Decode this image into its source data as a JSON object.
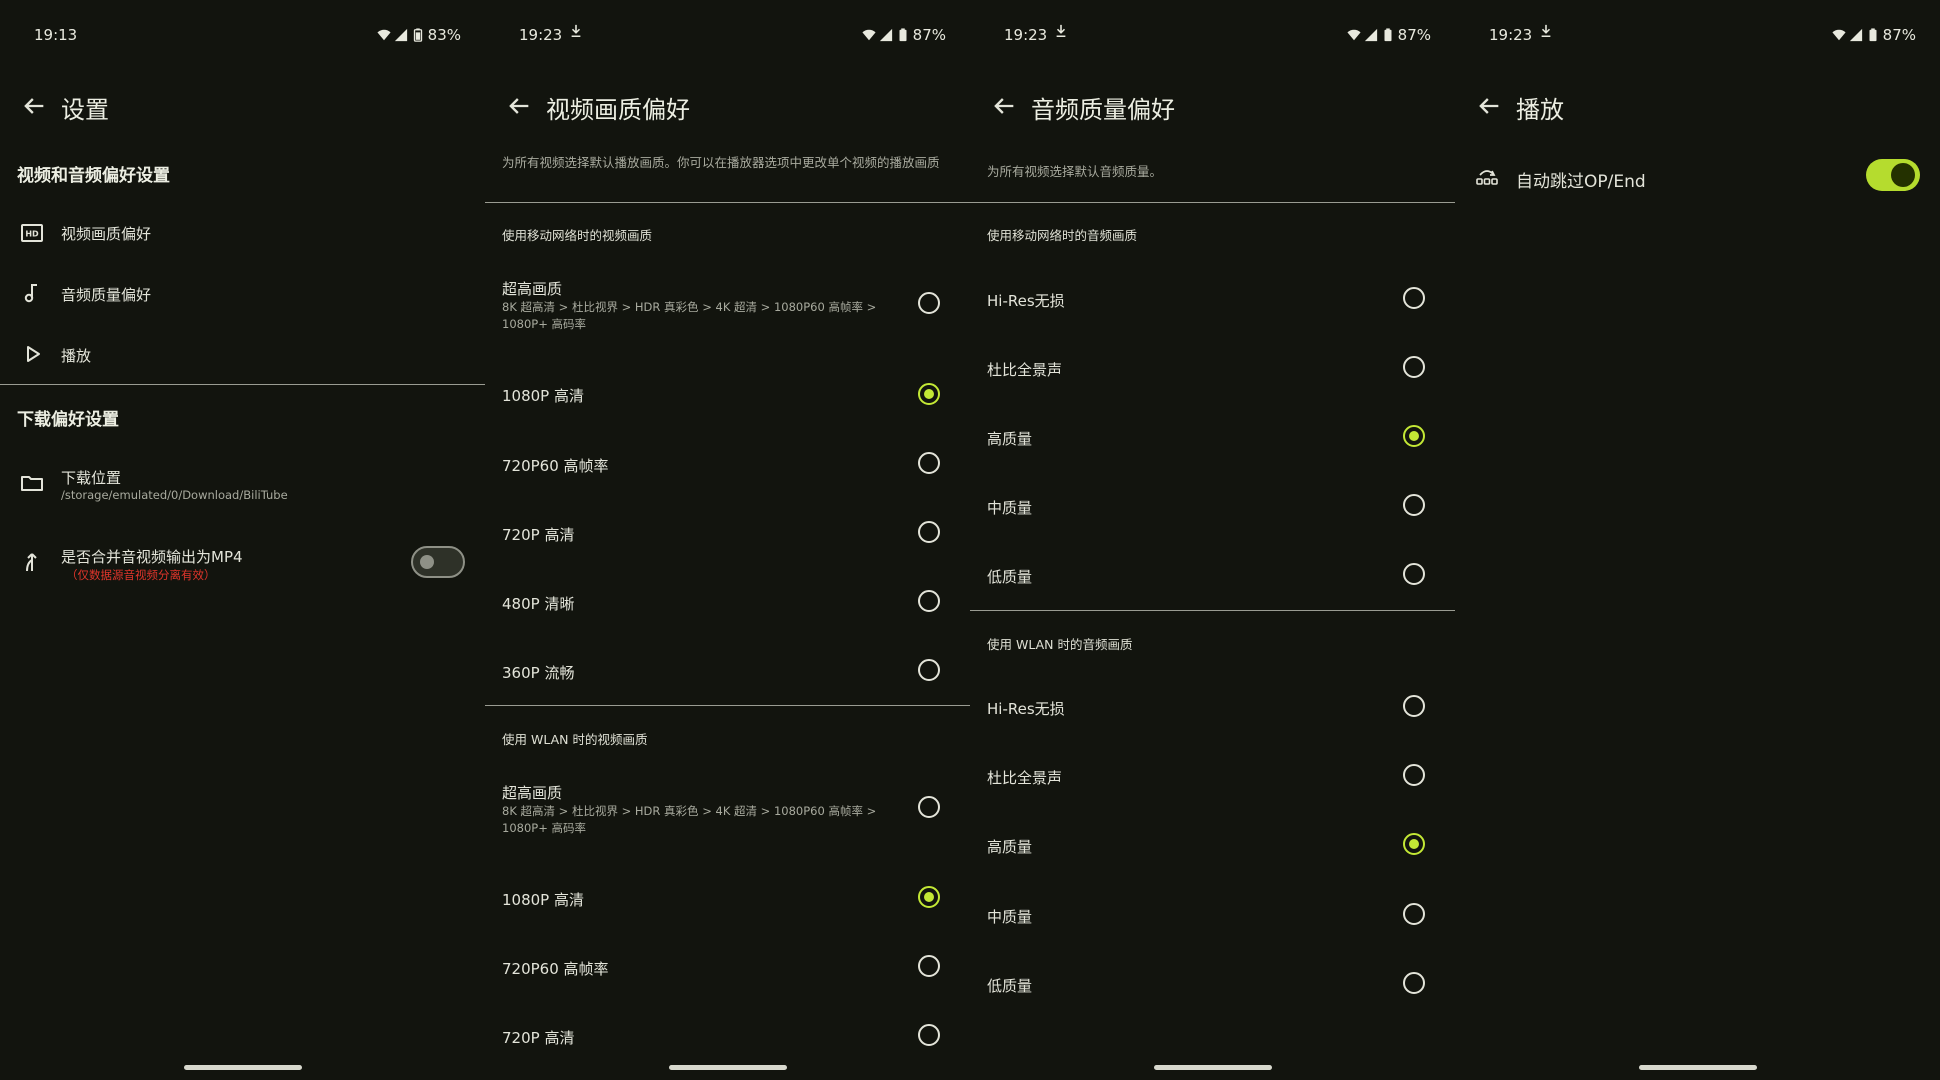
{
  "colors": {
    "background": "#12140e",
    "accent": "#c3e835",
    "warning": "#e0352b",
    "text": "#e3e4d9"
  },
  "screen1": {
    "status": {
      "time": "19:13",
      "battery": "83%"
    },
    "title": "设置",
    "section_av": "视频和音频偏好设置",
    "items": [
      {
        "icon": "hd-icon",
        "label": "视频画质偏好"
      },
      {
        "icon": "music-note-icon",
        "label": "音频质量偏好"
      },
      {
        "icon": "play-icon",
        "label": "播放"
      }
    ],
    "section_dl": "下载偏好设置",
    "download_location": {
      "label": "下载位置",
      "path": "/storage/emulated/0/Download/BiliTube"
    },
    "merge": {
      "label": "是否合并音视频输出为MP4",
      "note": "（仅数据源音视频分离有效）",
      "enabled": false
    }
  },
  "screen2": {
    "status": {
      "time": "19:23",
      "battery": "87%"
    },
    "title": "视频画质偏好",
    "description": "为所有视频选择默认播放画质。你可以在播放器选项中更改单个视频的播放画质",
    "mobile": {
      "header": "使用移动网络时的视频画质",
      "options": [
        {
          "label": "超高画质",
          "sub": "8K 超高清 > 杜比视界 > HDR 真彩色 > 4K 超清 > 1080P60 高帧率 > 1080P+ 高码率",
          "selected": false
        },
        {
          "label": "1080P 高清",
          "selected": true
        },
        {
          "label": "720P60 高帧率",
          "selected": false
        },
        {
          "label": "720P 高清",
          "selected": false
        },
        {
          "label": "480P 清晰",
          "selected": false
        },
        {
          "label": "360P 流畅",
          "selected": false
        }
      ]
    },
    "wlan": {
      "header": "使用 WLAN 时的视频画质",
      "options": [
        {
          "label": "超高画质",
          "sub": "8K 超高清 > 杜比视界 > HDR 真彩色 > 4K 超清 > 1080P60 高帧率 > 1080P+ 高码率",
          "selected": false
        },
        {
          "label": "1080P 高清",
          "selected": true
        },
        {
          "label": "720P60 高帧率",
          "selected": false
        },
        {
          "label": "720P 高清",
          "selected": false
        }
      ]
    }
  },
  "screen3": {
    "status": {
      "time": "19:23",
      "battery": "87%"
    },
    "title": "音频质量偏好",
    "description": "为所有视频选择默认音频质量。",
    "mobile": {
      "header": "使用移动网络时的音频画质",
      "options": [
        {
          "label": "Hi-Res无损",
          "selected": false
        },
        {
          "label": "杜比全景声",
          "selected": false
        },
        {
          "label": "高质量",
          "selected": true
        },
        {
          "label": "中质量",
          "selected": false
        },
        {
          "label": "低质量",
          "selected": false
        }
      ]
    },
    "wlan": {
      "header": "使用 WLAN 时的音频画质",
      "options": [
        {
          "label": "Hi-Res无损",
          "selected": false
        },
        {
          "label": "杜比全景声",
          "selected": false
        },
        {
          "label": "高质量",
          "selected": true
        },
        {
          "label": "中质量",
          "selected": false
        },
        {
          "label": "低质量",
          "selected": false
        }
      ]
    }
  },
  "screen4": {
    "status": {
      "time": "19:23",
      "battery": "87%"
    },
    "title": "播放",
    "skip": {
      "icon": "skip-icon",
      "label": "自动跳过OP/End",
      "enabled": true
    }
  }
}
